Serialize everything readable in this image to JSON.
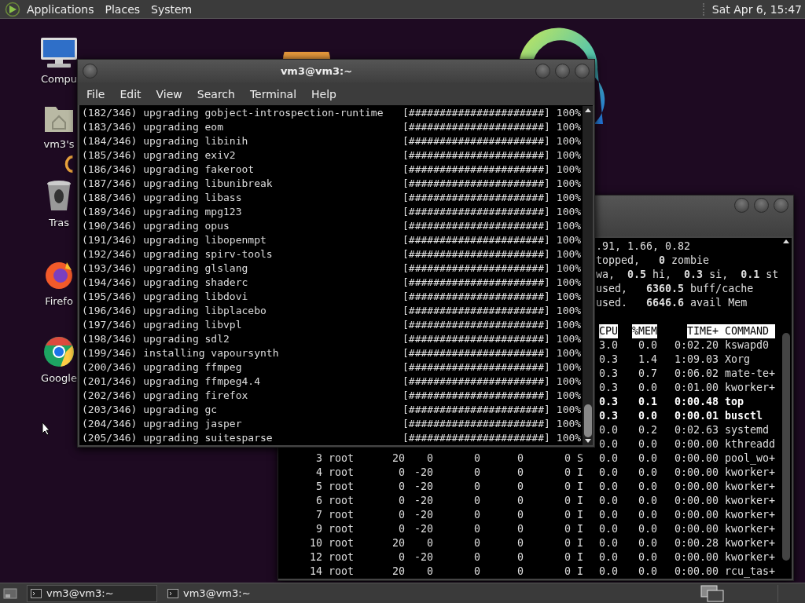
{
  "top_panel": {
    "menus": [
      "Applications",
      "Places",
      "System"
    ],
    "clock": "Sat Apr  6, 15:47"
  },
  "desktop_icons": [
    {
      "kind": "computer",
      "label": "Compu"
    },
    {
      "kind": "home",
      "label": "vm3's"
    },
    {
      "kind": "trash",
      "label": "Tras"
    },
    {
      "kind": "firefox",
      "label": "Firefo"
    },
    {
      "kind": "chrome",
      "label": "Google"
    }
  ],
  "back_window": {
    "summary_lines": [
      ".91, 1.66, 0.82",
      "topped,   **0** zombie",
      "wa,  **0.5** hi,  **0.3** si,  **0.1** st",
      "used,   **6360.5** buff/cache",
      "used.   **6646.6** avail Mem"
    ],
    "header": [
      "CPU",
      "%MEM",
      "TIME+",
      "COMMAND"
    ],
    "partial_rows": [
      {
        "cpu": "3.0",
        "mem": "0.0",
        "time": "0:02.20",
        "command": "kswapd0",
        "bold": false
      },
      {
        "cpu": "0.3",
        "mem": "1.4",
        "time": "1:09.03",
        "command": "Xorg",
        "bold": false
      },
      {
        "cpu": "0.3",
        "mem": "0.7",
        "time": "0:06.02",
        "command": "mate-te+",
        "bold": false
      },
      {
        "cpu": "0.3",
        "mem": "0.0",
        "time": "0:01.00",
        "command": "kworker+",
        "bold": false
      },
      {
        "cpu": "0.3",
        "mem": "0.1",
        "time": "0:00.48",
        "command": "top",
        "bold": true
      },
      {
        "cpu": "0.3",
        "mem": "0.0",
        "time": "0:00.01",
        "command": "busctl",
        "bold": true
      },
      {
        "cpu": "0.0",
        "mem": "0.2",
        "time": "0:02.63",
        "command": "systemd",
        "bold": false
      },
      {
        "cpu": "0.0",
        "mem": "0.0",
        "time": "0:00.00",
        "command": "kthreadd",
        "bold": false
      }
    ],
    "rows": [
      {
        "pid": "3",
        "user": "root",
        "pr": "20",
        "ni": "0",
        "virt": "0",
        "res": "0",
        "shr": "0",
        "s": "S",
        "cpu": "0.0",
        "mem": "0.0",
        "time": "0:00.00",
        "command": "pool_wo+"
      },
      {
        "pid": "4",
        "user": "root",
        "pr": "0",
        "ni": "-20",
        "virt": "0",
        "res": "0",
        "shr": "0",
        "s": "I",
        "cpu": "0.0",
        "mem": "0.0",
        "time": "0:00.00",
        "command": "kworker+"
      },
      {
        "pid": "5",
        "user": "root",
        "pr": "0",
        "ni": "-20",
        "virt": "0",
        "res": "0",
        "shr": "0",
        "s": "I",
        "cpu": "0.0",
        "mem": "0.0",
        "time": "0:00.00",
        "command": "kworker+"
      },
      {
        "pid": "6",
        "user": "root",
        "pr": "0",
        "ni": "-20",
        "virt": "0",
        "res": "0",
        "shr": "0",
        "s": "I",
        "cpu": "0.0",
        "mem": "0.0",
        "time": "0:00.00",
        "command": "kworker+"
      },
      {
        "pid": "7",
        "user": "root",
        "pr": "0",
        "ni": "-20",
        "virt": "0",
        "res": "0",
        "shr": "0",
        "s": "I",
        "cpu": "0.0",
        "mem": "0.0",
        "time": "0:00.00",
        "command": "kworker+"
      },
      {
        "pid": "9",
        "user": "root",
        "pr": "0",
        "ni": "-20",
        "virt": "0",
        "res": "0",
        "shr": "0",
        "s": "I",
        "cpu": "0.0",
        "mem": "0.0",
        "time": "0:00.00",
        "command": "kworker+"
      },
      {
        "pid": "10",
        "user": "root",
        "pr": "20",
        "ni": "0",
        "virt": "0",
        "res": "0",
        "shr": "0",
        "s": "I",
        "cpu": "0.0",
        "mem": "0.0",
        "time": "0:00.28",
        "command": "kworker+"
      },
      {
        "pid": "12",
        "user": "root",
        "pr": "0",
        "ni": "-20",
        "virt": "0",
        "res": "0",
        "shr": "0",
        "s": "I",
        "cpu": "0.0",
        "mem": "0.0",
        "time": "0:00.00",
        "command": "kworker+"
      },
      {
        "pid": "14",
        "user": "root",
        "pr": "20",
        "ni": "0",
        "virt": "0",
        "res": "0",
        "shr": "0",
        "s": "I",
        "cpu": "0.0",
        "mem": "0.0",
        "time": "0:00.00",
        "command": "rcu_tas+"
      }
    ]
  },
  "front_window": {
    "title": "vm3@vm3:~",
    "menu": [
      "File",
      "Edit",
      "View",
      "Search",
      "Terminal",
      "Help"
    ],
    "lines": [
      {
        "text": "(182/346) upgrading gobject-introspection-runtime",
        "bar": "[######################]",
        "percent": "100%"
      },
      {
        "text": "(183/346) upgrading eom",
        "bar": "[######################]",
        "percent": "100%"
      },
      {
        "text": "(184/346) upgrading libinih",
        "bar": "[######################]",
        "percent": "100%"
      },
      {
        "text": "(185/346) upgrading exiv2",
        "bar": "[######################]",
        "percent": "100%"
      },
      {
        "text": "(186/346) upgrading fakeroot",
        "bar": "[######################]",
        "percent": "100%"
      },
      {
        "text": "(187/346) upgrading libunibreak",
        "bar": "[######################]",
        "percent": "100%"
      },
      {
        "text": "(188/346) upgrading libass",
        "bar": "[######################]",
        "percent": "100%"
      },
      {
        "text": "(189/346) upgrading mpg123",
        "bar": "[######################]",
        "percent": "100%"
      },
      {
        "text": "(190/346) upgrading opus",
        "bar": "[######################]",
        "percent": "100%"
      },
      {
        "text": "(191/346) upgrading libopenmpt",
        "bar": "[######################]",
        "percent": "100%"
      },
      {
        "text": "(192/346) upgrading spirv-tools",
        "bar": "[######################]",
        "percent": "100%"
      },
      {
        "text": "(193/346) upgrading glslang",
        "bar": "[######################]",
        "percent": "100%"
      },
      {
        "text": "(194/346) upgrading shaderc",
        "bar": "[######################]",
        "percent": "100%"
      },
      {
        "text": "(195/346) upgrading libdovi",
        "bar": "[######################]",
        "percent": "100%"
      },
      {
        "text": "(196/346) upgrading libplacebo",
        "bar": "[######################]",
        "percent": "100%"
      },
      {
        "text": "(197/346) upgrading libvpl",
        "bar": "[######################]",
        "percent": "100%"
      },
      {
        "text": "(198/346) upgrading sdl2",
        "bar": "[######################]",
        "percent": "100%"
      },
      {
        "text": "(199/346) installing vapoursynth",
        "bar": "[######################]",
        "percent": "100%"
      },
      {
        "text": "(200/346) upgrading ffmpeg",
        "bar": "[######################]",
        "percent": "100%"
      },
      {
        "text": "(201/346) upgrading ffmpeg4.4",
        "bar": "[######################]",
        "percent": "100%"
      },
      {
        "text": "(202/346) upgrading firefox",
        "bar": "[######################]",
        "percent": "100%"
      },
      {
        "text": "(203/346) upgrading gc",
        "bar": "[######################]",
        "percent": "100%"
      },
      {
        "text": "(204/346) upgrading jasper",
        "bar": "[######################]",
        "percent": "100%"
      },
      {
        "text": "(205/346) upgrading suitesparse",
        "bar": "[######################]",
        "percent": "100%"
      }
    ]
  },
  "taskbar": {
    "buttons": [
      {
        "label": "vm3@vm3:~",
        "selected": true
      },
      {
        "label": "vm3@vm3:~",
        "selected": false
      }
    ]
  }
}
